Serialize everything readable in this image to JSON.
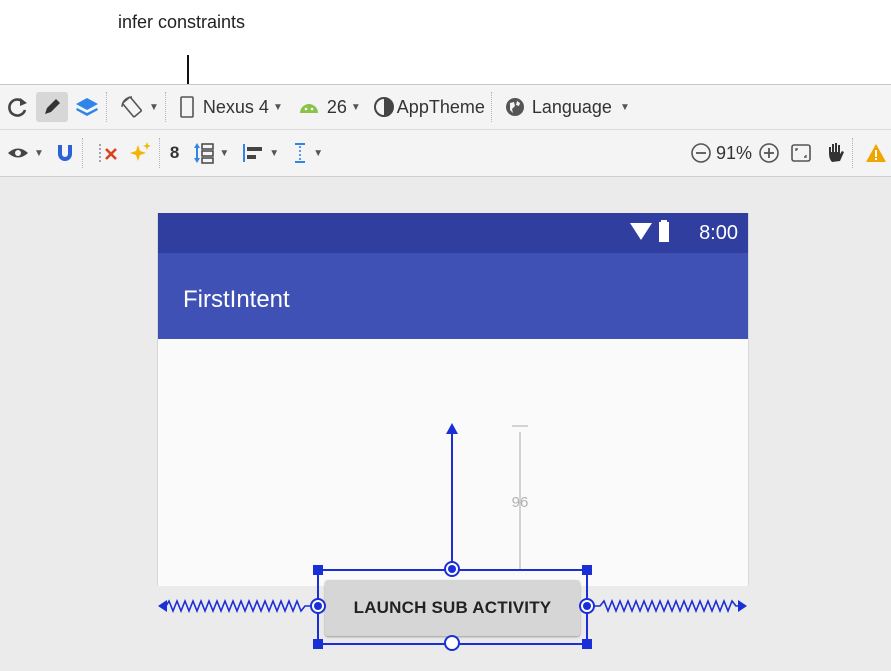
{
  "annotation": {
    "label": "infer constraints"
  },
  "toolbar_top": {
    "device": "Nexus 4",
    "api_level": "26",
    "theme": "AppTheme",
    "language": "Language"
  },
  "toolbar_bottom": {
    "margin_value": "8",
    "zoom_level": "91%"
  },
  "phone": {
    "time": "8:00",
    "app_title": "FirstIntent"
  },
  "button": {
    "label": "LAUNCH SUB ACTIVITY"
  },
  "constraint": {
    "top_margin": "96"
  },
  "colors": {
    "status_bar": "#303f9f",
    "app_bar": "#3f51b5",
    "constraint_blue": "#1a2fd6",
    "infer_icon": "#f5b400",
    "warning": "#f0a500"
  }
}
